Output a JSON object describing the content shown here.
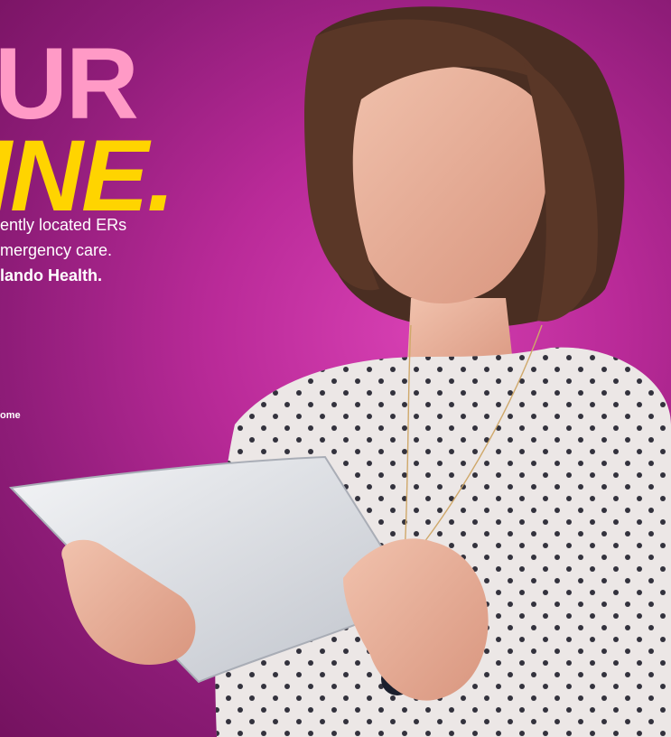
{
  "hero": {
    "headline_line1": "UR",
    "headline_line2": "INE.",
    "body_line1": "ently located ERs",
    "body_line2": "mergency care.",
    "body_line3": "lando Health.",
    "fine_link": "ome"
  },
  "colors": {
    "background": "#b92a98",
    "headline_pink": "#ff9ac6",
    "headline_yellow": "#ffd400",
    "text": "#ffffff"
  }
}
